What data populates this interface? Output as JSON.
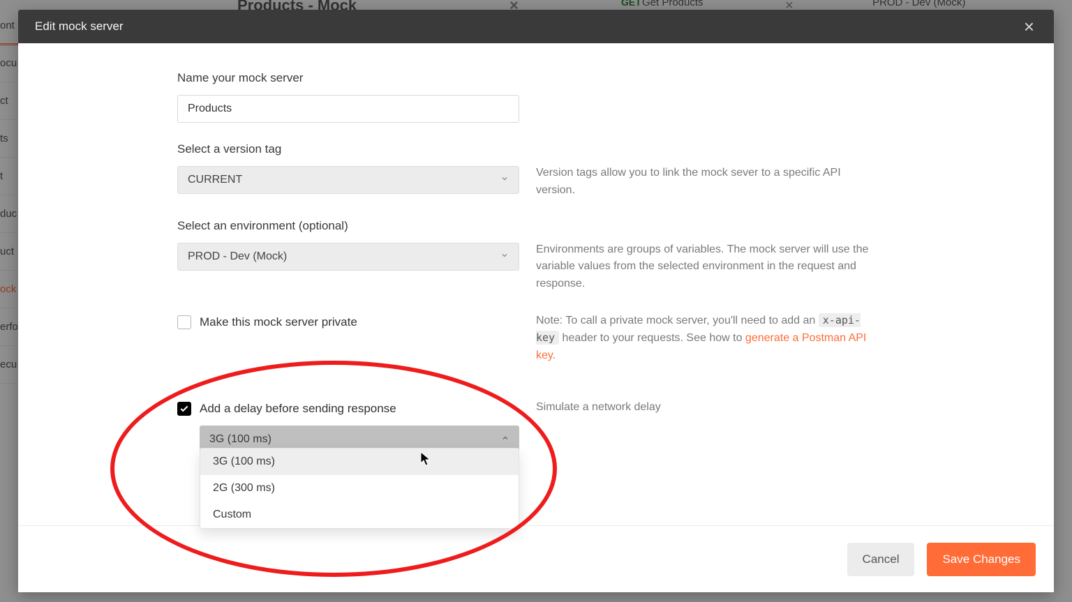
{
  "background": {
    "tab1": "Products - Mock",
    "tab2_prefix": "GET",
    "tab2": "Get Products",
    "env_pill": "PROD - Dev (Mock)",
    "side": [
      "ont",
      "ocu",
      "ct",
      "ts",
      "t",
      "duc",
      "uct",
      "ock",
      "erfo",
      "ecu"
    ]
  },
  "modal": {
    "title": "Edit mock server",
    "fields": {
      "name_label": "Name your mock server",
      "name_value": "Products",
      "version_label": "Select a version tag",
      "version_value": "CURRENT",
      "version_help": "Version tags allow you to link the mock sever to a specific API version.",
      "env_label": "Select an environment (optional)",
      "env_value": "PROD - Dev (Mock)",
      "env_help": "Environments are groups of variables. The mock server will use the variable values from the selected environment in the request and response.",
      "private_label": "Make this mock server private",
      "private_help_a": "Note: To call a private mock server, you'll need to add an ",
      "private_code": "x-api-key",
      "private_help_b": " header to your requests. See how to ",
      "private_link": "generate a Postman API key",
      "delay_label": "Add a delay before sending response",
      "delay_help": "Simulate a network delay",
      "delay_selected": "3G (100 ms)",
      "delay_options": [
        "3G (100 ms)",
        "2G (300 ms)",
        "Custom"
      ]
    },
    "buttons": {
      "cancel": "Cancel",
      "save": "Save Changes"
    }
  }
}
